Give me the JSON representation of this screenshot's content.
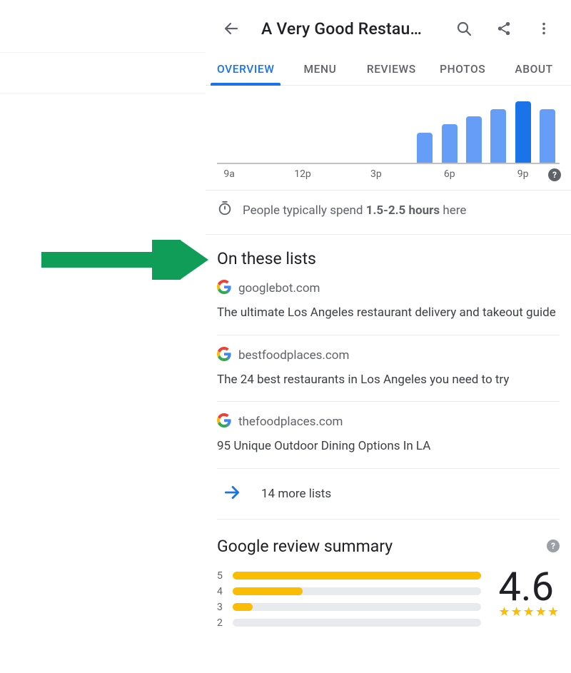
{
  "header": {
    "title": "A Very Good Restau…"
  },
  "tabs": {
    "items": [
      {
        "label": "OVERVIEW",
        "active": true
      },
      {
        "label": "MENU",
        "active": false
      },
      {
        "label": "REVIEWS",
        "active": false
      },
      {
        "label": "PHOTOS",
        "active": false
      },
      {
        "label": "ABOUT",
        "active": false
      }
    ]
  },
  "chart_data": {
    "type": "bar",
    "title": "",
    "xlabel": "",
    "ylabel": "",
    "ylim": [
      0,
      100
    ],
    "categories": [
      "9a",
      "10a",
      "11a",
      "12p",
      "1p",
      "2p",
      "3p",
      "4p",
      "5p",
      "6p",
      "7p",
      "8p",
      "9p",
      "10p"
    ],
    "values": [
      0,
      0,
      0,
      0,
      0,
      0,
      0,
      0,
      44,
      56,
      68,
      78,
      90,
      78
    ],
    "peak_index": 12,
    "visible_ticks": [
      "9a",
      "12p",
      "3p",
      "6p",
      "9p"
    ]
  },
  "spend": {
    "prefix": "People typically spend ",
    "duration": "1.5-2.5 hours",
    "suffix": " here"
  },
  "lists_section": {
    "heading": "On these lists",
    "items": [
      {
        "source": "googlebot.com",
        "title": "The ultimate Los Angeles restaurant delivery and takeout guide"
      },
      {
        "source": "bestfoodplaces.com",
        "title": "The 24 best restaurants in Los Angeles you need to try"
      },
      {
        "source": "thefoodplaces.com",
        "title": "95 Unique Outdoor Dining Options In LA"
      }
    ],
    "more": "14 more lists"
  },
  "reviews": {
    "heading": "Google review summary",
    "score": "4.6",
    "stars": "★★★★★",
    "dist": [
      {
        "label": "5",
        "pct": 100
      },
      {
        "label": "4",
        "pct": 28
      },
      {
        "label": "3",
        "pct": 8
      },
      {
        "label": "2",
        "pct": 0
      }
    ]
  }
}
